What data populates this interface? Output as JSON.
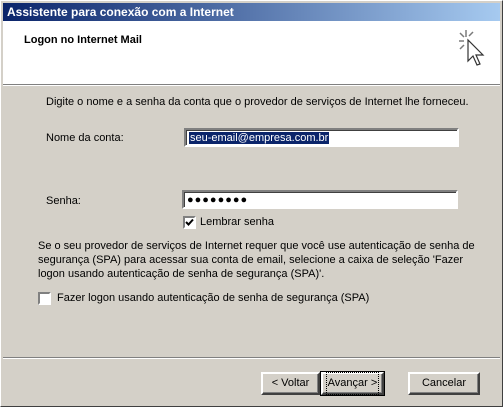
{
  "window": {
    "title": "Assistente para conexão com a Internet"
  },
  "header": {
    "title": "Logon no Internet Mail",
    "icon": "wizard-sparkle-cursor-icon"
  },
  "body": {
    "instructions": "Digite o nome e a senha da conta que o provedor de serviços de Internet lhe forneceu.",
    "account_label": "Nome da conta:",
    "account_value": "seu-email@empresa.com.br",
    "password_label": "Senha:",
    "password_value": "●●●●●●●●",
    "remember_label": "Lembrar senha",
    "remember_checked": true,
    "spa_paragraph": "Se o seu provedor de serviços de Internet requer que você use autenticação de senha de segurança (SPA) para acessar sua conta de email, selecione a caixa de seleção 'Fazer logon usando autenticação de senha de segurança (SPA)'.",
    "spa_label": "Fazer logon usando autenticação de senha de segurança (SPA)",
    "spa_checked": false
  },
  "buttons": {
    "back": "< Voltar",
    "next": "Avançar >",
    "cancel": "Cancelar"
  }
}
